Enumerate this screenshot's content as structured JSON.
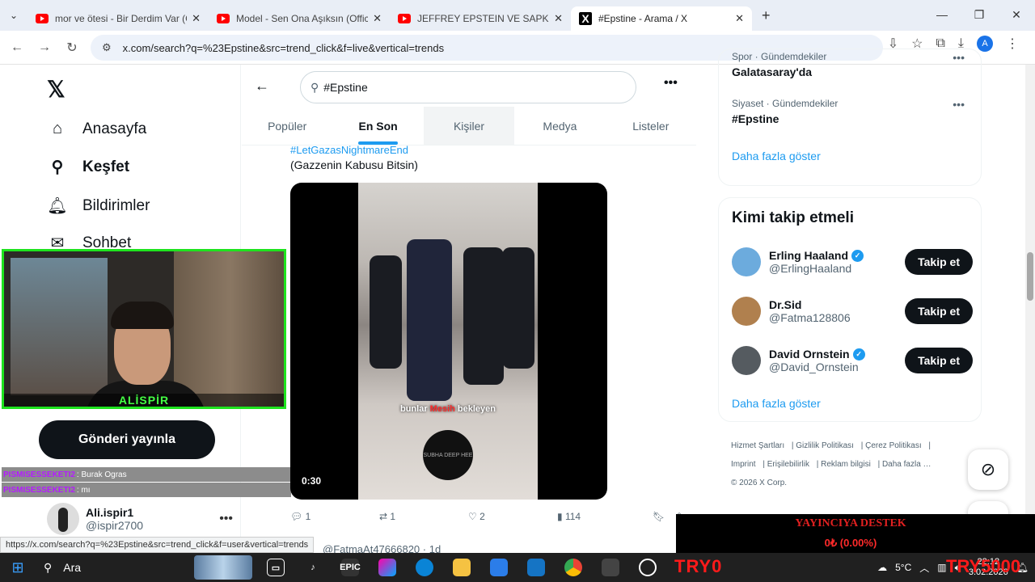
{
  "browser": {
    "tabs": [
      {
        "title": "mor ve ötesi - Bir Derdim Var (C",
        "icon": "youtube-icon"
      },
      {
        "title": "Model - Sen Ona Aşıksın (Offici",
        "icon": "youtube-icon"
      },
      {
        "title": "JEFFREY EPSTEIN VE SAPKIN EP",
        "icon": "youtube-icon"
      },
      {
        "title": "#Epstine - Arama / X",
        "icon": "x-icon"
      }
    ],
    "url": "x.com/search?q=%23Epstine&src=trend_click&f=live&vertical=trends",
    "status_url": "https://x.com/search?q=%23Epstine&src=trend_click&f=user&vertical=trends",
    "profile_initial": "A"
  },
  "nav": {
    "items": [
      {
        "label": "Anasayfa",
        "icon": "home-icon"
      },
      {
        "label": "Keşfet",
        "icon": "search-icon"
      },
      {
        "label": "Bildirimler",
        "icon": "bell-icon"
      },
      {
        "label": "Sohbet",
        "icon": "mail-icon"
      }
    ],
    "post_button": "Gönderi yayınla",
    "profile": {
      "name": "Ali.ispir1",
      "handle": "@ispir2700"
    }
  },
  "webcam": {
    "name": "ALİSPİR"
  },
  "chat": [
    {
      "user": "PISMISESSEKETI2",
      "text": ": Burak Ogras"
    },
    {
      "user": "PISMISESSEKETI2",
      "text": ": mı"
    }
  ],
  "search": {
    "query": "#Epstine",
    "tabs": [
      "Popüler",
      "En Son",
      "Kişiler",
      "Medya",
      "Listeler"
    ],
    "selected_tab": "En Son"
  },
  "tweet": {
    "hashtag": "#LetGazasNightmareEnd",
    "text": "(Gazzenin Kabusu Bitsin)",
    "video": {
      "subtitle_before": "bunlar",
      "subtitle_mid": "Mesih",
      "subtitle_after": "bekleyen",
      "logo_text": "SUBHA DEEP HEE",
      "duration": "0:30"
    },
    "replies": "1",
    "reposts": "1",
    "likes": "2",
    "views": "114",
    "next_tweet": "@FatmaAt47666820 · 1d"
  },
  "trends": [
    {
      "category": "Spor · Gündemdekiler",
      "name": "Galatasaray'da"
    },
    {
      "category": "Siyaset · Gündemdekiler",
      "name": "#Epstine"
    }
  ],
  "show_more": "Daha fazla göster",
  "who_to_follow": {
    "title": "Kimi takip etmeli",
    "button": "Takip et",
    "accounts": [
      {
        "name": "Erling Haaland",
        "handle": "@ErlingHaaland",
        "verified": true,
        "color": "#6cabdd"
      },
      {
        "name": "Dr.Sid",
        "handle": "@Fatma128806",
        "verified": false,
        "color": "#b0804e"
      },
      {
        "name": "David Ornstein",
        "handle": "@David_Ornstein",
        "verified": true,
        "color": "#555b60"
      }
    ]
  },
  "footer": {
    "links": [
      "Hizmet Şartları",
      "Gizlilik Politikası",
      "Çerez Politikası",
      "Imprint",
      "Erişilebilirlik",
      "Reklam bilgisi",
      "Daha fazla …"
    ],
    "copyright": "© 2026 X Corp."
  },
  "stream": {
    "donate_label": "YAYINCIYA DESTEK",
    "donate_amount": "0₺ (0.00%)",
    "overlay_left": "TRY0",
    "overlay_right": "TRY5000"
  },
  "taskbar": {
    "search": "Ara",
    "temperature": "5°C",
    "time": "22:12",
    "date": "3.02.2026"
  },
  "colors": {
    "accent": "#1d9bf0",
    "webcam_border": "#1ee31e"
  }
}
